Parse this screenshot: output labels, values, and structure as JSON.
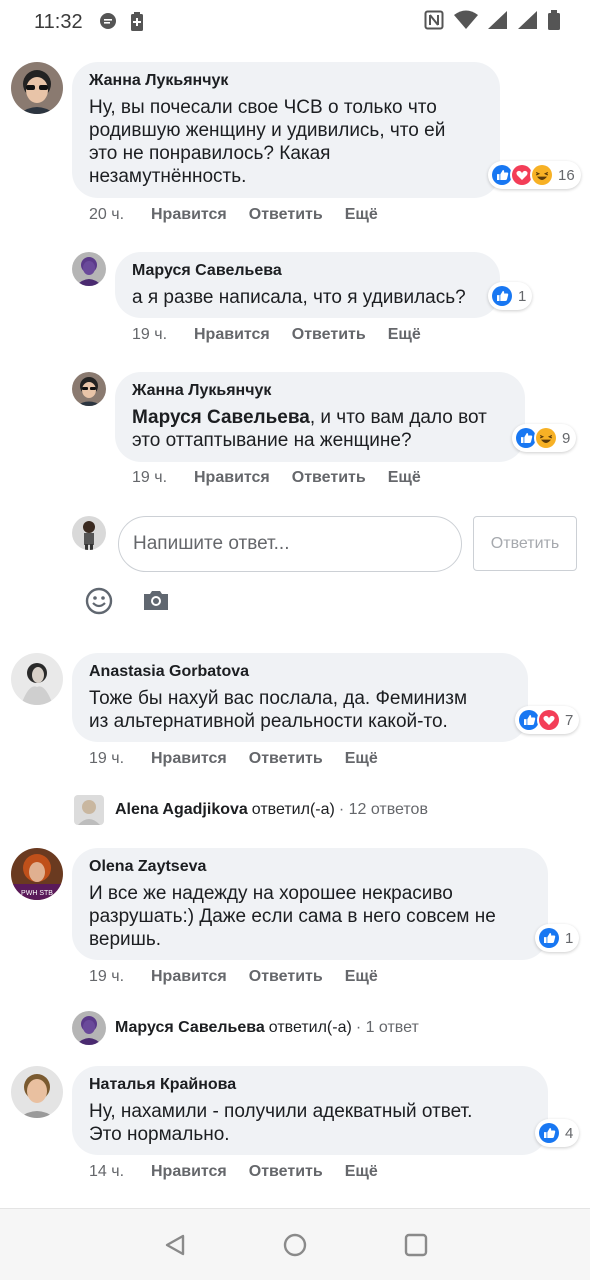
{
  "status": {
    "time": "11:32"
  },
  "comments": [
    {
      "author": "Жанна Лукьянчук",
      "text": "Ну, вы почесали свое ЧСВ о только что\nродившую женщину и удивились, что ей\nэто не понравилось? Какая\nнезамутнённость.",
      "reaction_count": "16",
      "time": "20 ч.",
      "like": "Нравится",
      "reply": "Ответить",
      "more": "Ещё"
    },
    {
      "author": "Маруся Савельева",
      "text": "а я разве написала, что я удивилась?",
      "reaction_count": "1",
      "time": "19 ч.",
      "like": "Нравится",
      "reply": "Ответить",
      "more": "Ещё"
    },
    {
      "author": "Жанна Лукьянчук",
      "mention": "Маруся Савельева",
      "text": ", и что вам дало вот\nэто оттаптывание на женщине?",
      "reaction_count": "9",
      "time": "19 ч.",
      "like": "Нравится",
      "reply": "Ответить",
      "more": "Ещё"
    },
    {
      "author": "Anastasia Gorbatova",
      "text": "Тоже бы нахуй вас послала, да. Феминизм\nиз альтернативной реальности какой-то.",
      "reaction_count": "7",
      "time": "19 ч.",
      "like": "Нравится",
      "reply": "Ответить",
      "more": "Ещё"
    },
    {
      "author": "Olena Zaytseva",
      "text": "И все же надежду на хорошее некрасиво\nразрушать:) Даже если сама в него совсем не\nверишь.",
      "reaction_count": "1",
      "time": "19 ч.",
      "like": "Нравится",
      "reply": "Ответить",
      "more": "Ещё"
    },
    {
      "author": "Наталья Крайнова",
      "text": "Ну, нахамили - получили адекватный ответ.\nЭто нормально.",
      "reaction_count": "4",
      "time": "14 ч.",
      "like": "Нравится",
      "reply": "Ответить",
      "more": "Ещё"
    }
  ],
  "reply_composer": {
    "placeholder": "Напишите ответ...",
    "submit_label": "Ответить"
  },
  "threads": [
    {
      "name": "Alena Agadjikova",
      "verb": "ответил(-а)",
      "count": "· 12 ответов"
    },
    {
      "name": "Маруся Савельева",
      "verb": "ответил(-а)",
      "count": "· 1 ответ"
    }
  ],
  "colors": {
    "like_blue": "#1877f2",
    "love_red": "#f33e58",
    "haha_yellow": "#f7b125",
    "bubble_bg": "#f0f2f5",
    "meta_gray": "#65676b"
  },
  "icons": [
    "like-icon",
    "love-icon",
    "haha-icon",
    "emoji-icon",
    "camera-icon",
    "back-icon",
    "home-icon",
    "recents-icon"
  ]
}
